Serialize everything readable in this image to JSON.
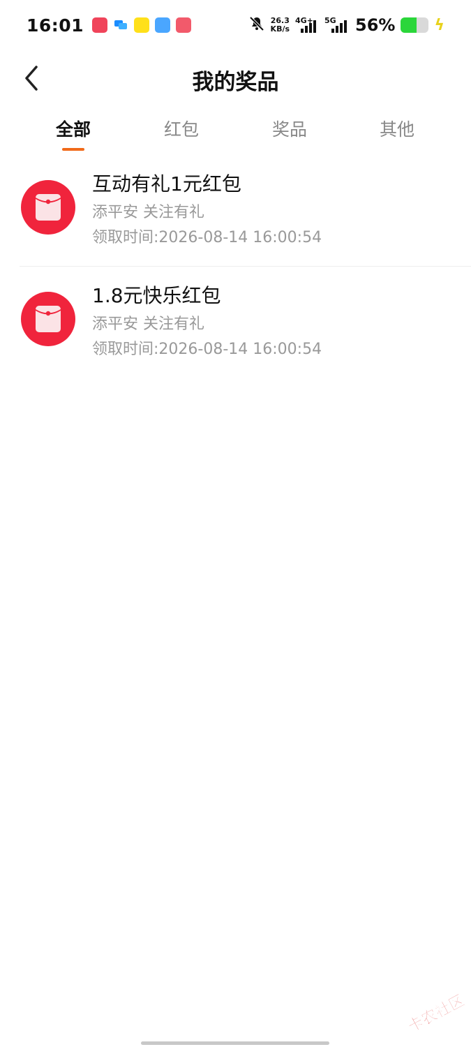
{
  "status_bar": {
    "time": "16:01",
    "speed_value": "26.3",
    "speed_unit": "KB/s",
    "network_1": "4G+",
    "network_2": "5G",
    "battery_percent": "56%",
    "battery_level": 0.56,
    "icons": [
      "app-icon-1",
      "chat-icon",
      "app-icon-3",
      "app-icon-4",
      "video-app-icon",
      "bell-muted-icon",
      "signal-icon",
      "battery-icon",
      "charging-icon"
    ]
  },
  "nav": {
    "title": "我的奖品",
    "back_icon": "chevron-left-icon"
  },
  "tabs": [
    {
      "label": "全部",
      "active": true
    },
    {
      "label": "红包",
      "active": false
    },
    {
      "label": "奖品",
      "active": false
    },
    {
      "label": "其他",
      "active": false
    }
  ],
  "prizes": [
    {
      "icon": "red-envelope-icon",
      "title": "互动有礼1元红包",
      "source": "添平安 关注有礼",
      "time": "领取时间:2026-08-14 16:00:54"
    },
    {
      "icon": "red-envelope-icon",
      "title": "1.8元快乐红包",
      "source": "添平安 关注有礼",
      "time": "领取时间:2026-08-14 16:00:54"
    }
  ],
  "watermark": {
    "text": "卡农社区"
  },
  "colors": {
    "accent": "#f16a1a",
    "envelope_red": "#f0243c",
    "battery_green": "#2bd63a"
  }
}
